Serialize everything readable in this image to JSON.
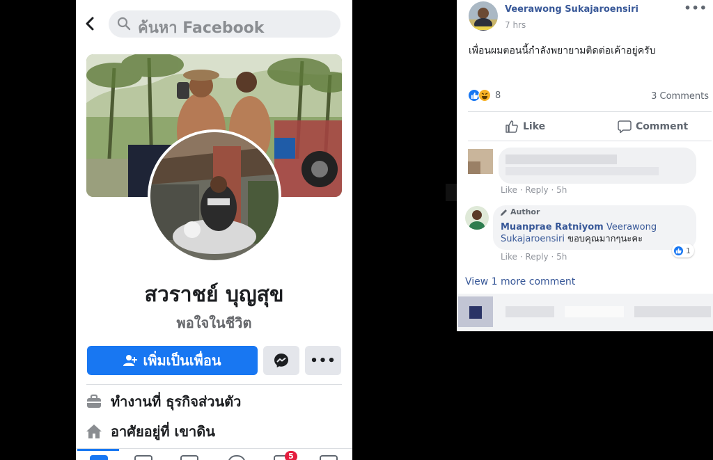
{
  "profile": {
    "search_placeholder": "ค้นหา Facebook",
    "name": "สวราชย์ บุญสุข",
    "bio": "พอใจในชีวิต",
    "add_friend_label": "เพิ่มเป็นเพื่อน",
    "more_label": "•••",
    "work": "ทำงานที่ ธุรกิจส่วนตัว",
    "lives": "อาศัยอยู่ที่ เขาดิน",
    "notification_badge": "5"
  },
  "post": {
    "author": "Veerawong Sukajaroensiri",
    "time": "7 hrs",
    "menu_label": "•••",
    "text": "เพื่อนผมตอนนี้กำลังพยายามติดต่อเค้าอยู่ครับ",
    "reaction_count": "8",
    "comments_count": "3 Comments",
    "like_label": "Like",
    "comment_label": "Comment",
    "comments": [
      {
        "like": "Like",
        "reply": "Reply",
        "age": "5h"
      },
      {
        "tag": "Author",
        "author": "Muanprae Ratniyom",
        "mention": "Veerawong Sukajaroensiri",
        "text": "ขอบคุณมากๆนะคะ",
        "reactions": "1",
        "like": "Like",
        "reply": "Reply",
        "age": "5h"
      }
    ],
    "view_more": "View 1 more comment"
  },
  "colors": {
    "facebook_blue": "#1877f2",
    "link_blue": "#385898",
    "notification_red": "#e41e3f"
  },
  "icons": [
    "back-arrow-icon",
    "search-icon",
    "add-person-icon",
    "messenger-icon",
    "briefcase-icon",
    "home-icon",
    "like-reaction-icon",
    "haha-reaction-icon",
    "thumbs-up-icon",
    "comment-icon",
    "pencil-icon"
  ]
}
